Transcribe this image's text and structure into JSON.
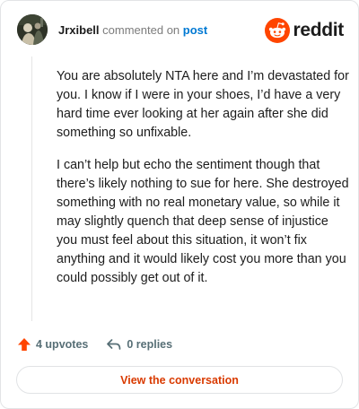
{
  "header": {
    "username": "Jrxibell",
    "action_text": "commented on",
    "post_link": "post",
    "brand": "reddit",
    "brand_color": "#ff4500",
    "link_color": "#0079d3"
  },
  "comment": {
    "paragraphs": [
      "You are absolutely NTA here and I’m devastated for you. I know if I were in your shoes, I’d have a very hard time ever looking at her again after she did something so unfixable.",
      "I can’t help but echo the sentiment though that there’s likely nothing to sue for here. She destroyed something with no real monetary value, so while it may slightly quench that deep sense of injustice you must feel about this situation, it won’t fix anything and it would likely cost you more than you could possibly get out of it."
    ]
  },
  "footer": {
    "upvotes_label": "4 upvotes",
    "replies_label": "0 replies",
    "upvote_icon": "upvote-arrow-icon",
    "reply_icon": "reply-arrow-icon",
    "upvote_color": "#ff4500"
  },
  "cta": {
    "label": "View the conversation",
    "color": "#d93a00"
  }
}
